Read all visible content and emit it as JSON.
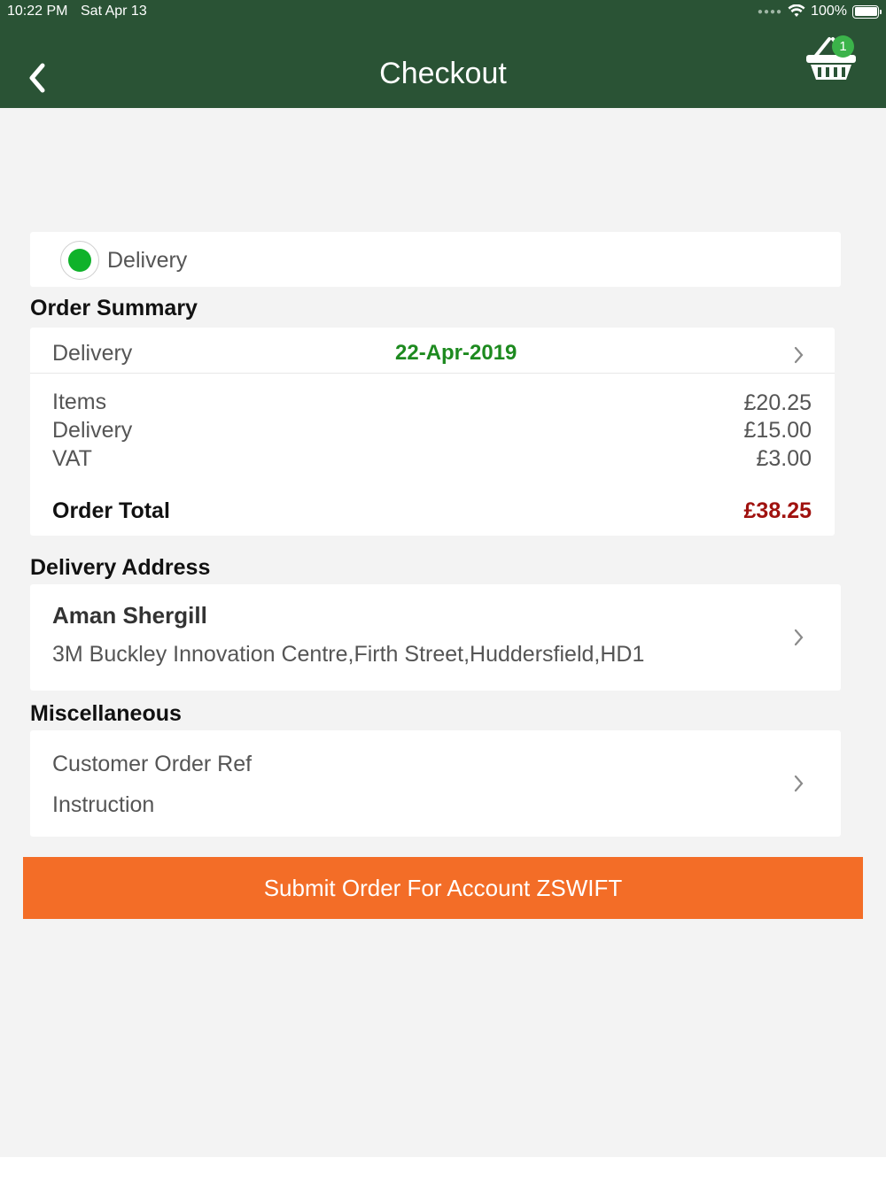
{
  "status_bar": {
    "time": "10:22 PM",
    "date": "Sat Apr 13",
    "battery": "100%"
  },
  "header": {
    "title": "Checkout",
    "basket_count": "1",
    "back_icon": "chevron-left-icon",
    "basket_icon": "basket-icon"
  },
  "delivery_option": {
    "label": "Delivery",
    "selected": true
  },
  "order_summary": {
    "title": "Order Summary",
    "delivery_label": "Delivery",
    "delivery_date": "22-Apr-2019",
    "items_label": "Items",
    "items_value": "£20.25",
    "delivery_cost_label": "Delivery",
    "delivery_cost_value": "£15.00",
    "vat_label": "VAT",
    "vat_value": "£3.00",
    "total_label": "Order Total",
    "total_value": "£38.25"
  },
  "delivery_address": {
    "title": "Delivery Address",
    "name": "Aman Shergill",
    "address": "3M Buckley Innovation Centre,Firth Street,Huddersfield,HD1"
  },
  "miscellaneous": {
    "title": "Miscellaneous",
    "customer_order_ref_label": "Customer Order Ref",
    "instruction_label": "Instruction"
  },
  "submit": {
    "label": "Submit Order For Account ZSWIFT"
  },
  "colors": {
    "header_bg": "#2a5335",
    "accent_green": "#1d8a1f",
    "total_red": "#a0120f",
    "submit_orange": "#f36d27"
  }
}
